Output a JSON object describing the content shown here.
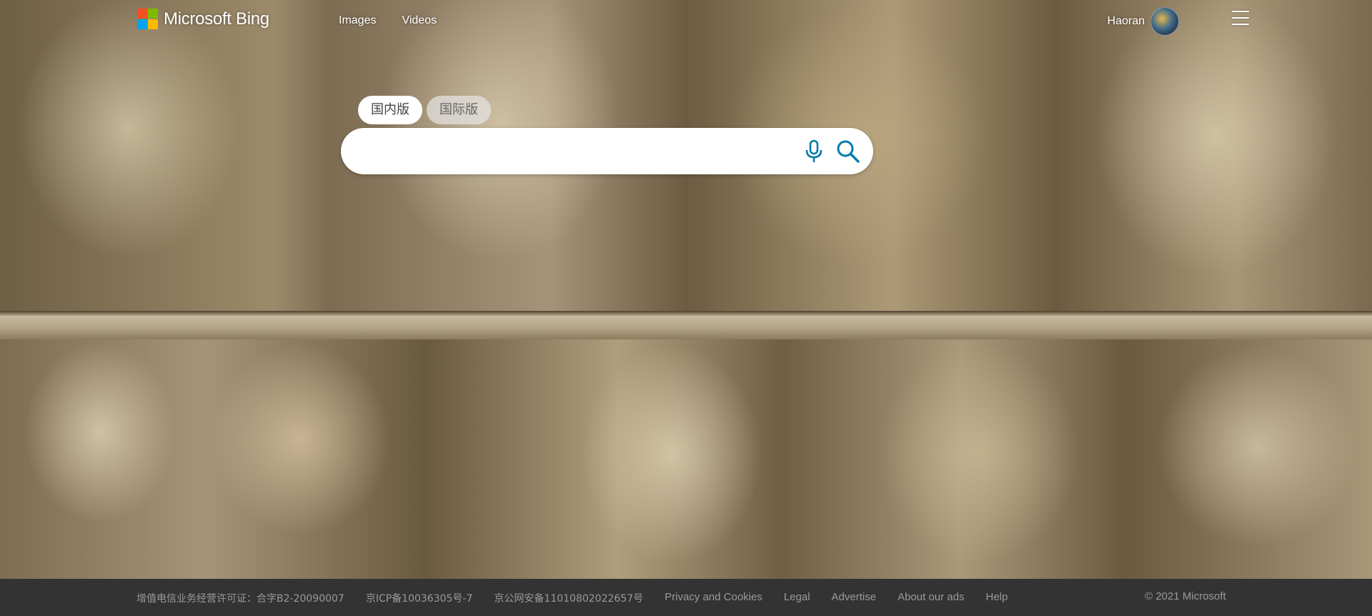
{
  "brand": {
    "logo_text": "Microsoft Bing",
    "logo_colors": [
      "#f25022",
      "#7fba00",
      "#00a4ef",
      "#ffb900"
    ]
  },
  "nav": {
    "items": [
      {
        "label": "Images"
      },
      {
        "label": "Videos"
      }
    ]
  },
  "user": {
    "name": "Haoran"
  },
  "search": {
    "scopes": [
      {
        "label": "国内版",
        "active": true
      },
      {
        "label": "国际版",
        "active": false
      }
    ],
    "value": "",
    "placeholder": "",
    "accent_color": "#007daa"
  },
  "footer": {
    "links": [
      {
        "label": "增值电信业务经营许可证：合字B2-20090007"
      },
      {
        "label": "京ICP备10036305号-7"
      },
      {
        "label": "京公网安备11010802022657号"
      },
      {
        "label": "Privacy and Cookies"
      },
      {
        "label": "Legal"
      },
      {
        "label": "Advertise"
      },
      {
        "label": "About our ads"
      },
      {
        "label": "Help"
      }
    ],
    "copyright": "© 2021 Microsoft"
  }
}
